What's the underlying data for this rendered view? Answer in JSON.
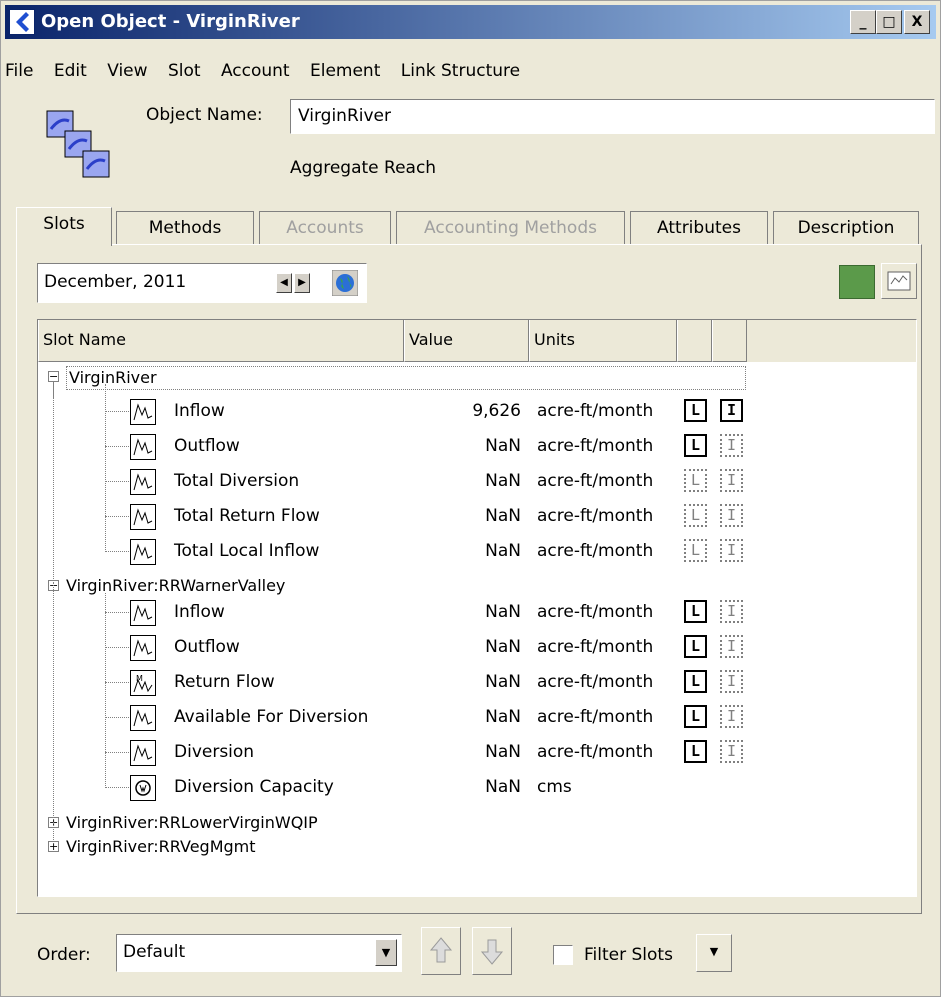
{
  "window": {
    "title": "Open Object - VirginRiver"
  },
  "titlebar_buttons": [
    "_",
    "□",
    "X"
  ],
  "menu": [
    "File",
    "Edit",
    "View",
    "Slot",
    "Account",
    "Element",
    "Link Structure"
  ],
  "object": {
    "name_label": "Object Name:",
    "name_value": "VirginRiver",
    "type": "Aggregate Reach"
  },
  "tabs": [
    {
      "label": "Slots",
      "active": true,
      "disabled": false
    },
    {
      "label": "Methods",
      "active": false,
      "disabled": false
    },
    {
      "label": "Accounts",
      "active": false,
      "disabled": true
    },
    {
      "label": "Accounting Methods",
      "active": false,
      "disabled": true
    },
    {
      "label": "Attributes",
      "active": false,
      "disabled": false
    },
    {
      "label": "Description",
      "active": false,
      "disabled": false
    }
  ],
  "date": {
    "value": "December, 2011"
  },
  "table": {
    "columns": [
      "Slot Name",
      "Value",
      "Units",
      "",
      ""
    ],
    "groups": [
      {
        "name": "VirginRiver",
        "expanded": true,
        "slots": [
          {
            "name": "Inflow",
            "value": "9,626",
            "units": "acre-ft/month",
            "icon": "series",
            "flag_l": "on",
            "flag_i": "on"
          },
          {
            "name": "Outflow",
            "value": "NaN",
            "units": "acre-ft/month",
            "icon": "series",
            "flag_l": "on",
            "flag_i": "off"
          },
          {
            "name": "Total Diversion",
            "value": "NaN",
            "units": "acre-ft/month",
            "icon": "series",
            "flag_l": "off",
            "flag_i": "off"
          },
          {
            "name": "Total Return Flow",
            "value": "NaN",
            "units": "acre-ft/month",
            "icon": "series",
            "flag_l": "off",
            "flag_i": "off"
          },
          {
            "name": "Total Local Inflow",
            "value": "NaN",
            "units": "acre-ft/month",
            "icon": "series",
            "flag_l": "off",
            "flag_i": "off"
          }
        ]
      },
      {
        "name": "VirginRiver:RRWarnerValley",
        "expanded": true,
        "slots": [
          {
            "name": "Inflow",
            "value": "NaN",
            "units": "acre-ft/month",
            "icon": "series",
            "flag_l": "on",
            "flag_i": "off"
          },
          {
            "name": "Outflow",
            "value": "NaN",
            "units": "acre-ft/month",
            "icon": "series",
            "flag_l": "on",
            "flag_i": "off"
          },
          {
            "name": "Return Flow",
            "value": "NaN",
            "units": "acre-ft/month",
            "icon": "multi-series",
            "flag_l": "on",
            "flag_i": "off"
          },
          {
            "name": "Available For Diversion",
            "value": "NaN",
            "units": "acre-ft/month",
            "icon": "series",
            "flag_l": "on",
            "flag_i": "off"
          },
          {
            "name": "Diversion",
            "value": "NaN",
            "units": "acre-ft/month",
            "icon": "series",
            "flag_l": "on",
            "flag_i": "off"
          },
          {
            "name": "Diversion Capacity",
            "value": "NaN",
            "units": "cms",
            "icon": "scalar",
            "flag_l": "none",
            "flag_i": "none"
          }
        ]
      },
      {
        "name": "VirginRiver:RRLowerVirginWQIP",
        "expanded": false,
        "slots": []
      },
      {
        "name": "VirginRiver:RRVegMgmt",
        "expanded": false,
        "slots": []
      }
    ]
  },
  "footer": {
    "order_label": "Order:",
    "order_value": "Default",
    "filter_label": "Filter Slots",
    "filter_checked": false
  },
  "colors": {
    "title_start": "#0a246a",
    "title_end": "#a6caf0",
    "chrome": "#ece9d8",
    "green_swatch": "#5b9a4a"
  }
}
